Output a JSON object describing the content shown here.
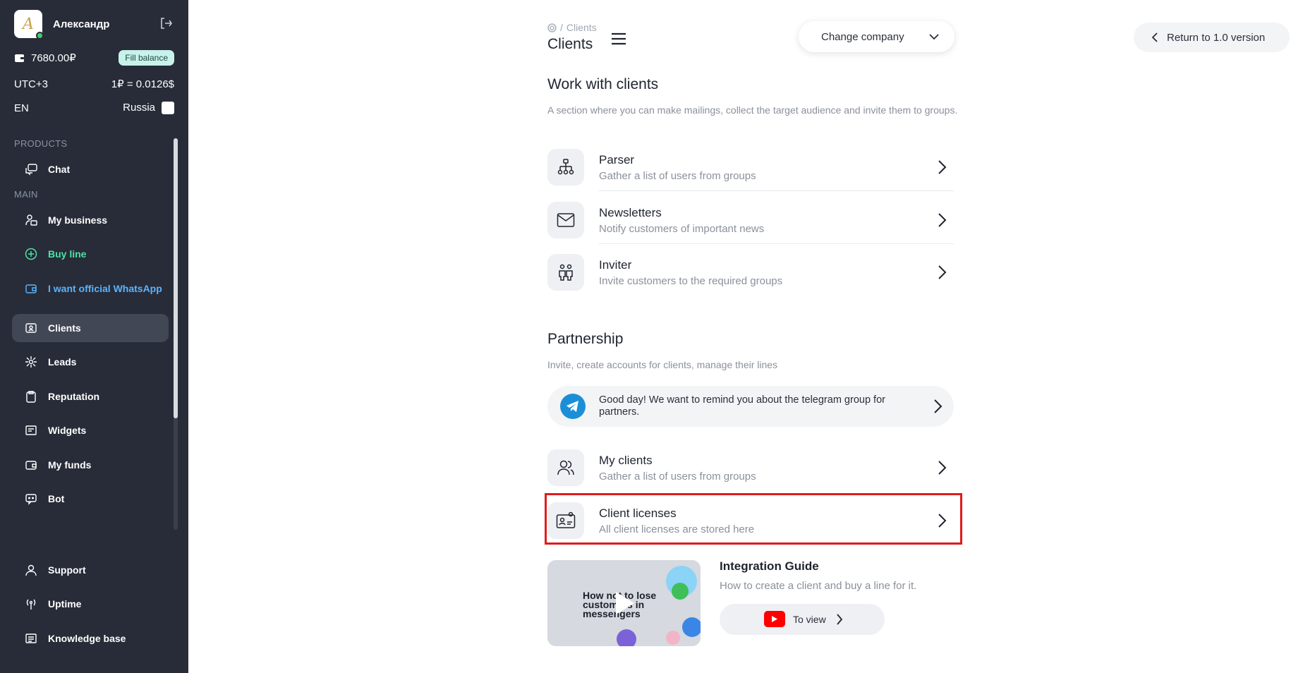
{
  "sidebar": {
    "user_name": "Александр",
    "balance": "7680.00₽",
    "fill_balance_label": "Fill balance",
    "timezone": "UTC+3",
    "rate": "1₽ = 0.0126$",
    "language": "EN",
    "country": "Russia",
    "sections": {
      "products": "PRODUCTS",
      "main": "MAIN"
    },
    "items": [
      {
        "label": "Chat",
        "icon": "chat-icon"
      },
      {
        "label": "My business",
        "icon": "business-icon"
      },
      {
        "label": "Buy line",
        "icon": "plus-circle-icon"
      },
      {
        "label": "I want official WhatsApp",
        "icon": "wallet-icon"
      },
      {
        "label": "Clients",
        "icon": "id-card-icon"
      },
      {
        "label": "Leads",
        "icon": "network-icon"
      },
      {
        "label": "Reputation",
        "icon": "clipboard-icon"
      },
      {
        "label": "Widgets",
        "icon": "widget-icon"
      },
      {
        "label": "My funds",
        "icon": "wallet-icon"
      },
      {
        "label": "Bot",
        "icon": "bot-icon"
      }
    ],
    "bottom_items": [
      {
        "label": "Support",
        "icon": "support-icon"
      },
      {
        "label": "Uptime",
        "icon": "antenna-icon"
      },
      {
        "label": "Knowledge base",
        "icon": "book-icon"
      }
    ],
    "colors": {
      "bg": "#272c38",
      "active": "#414755",
      "green": "#4be3a6",
      "blue": "#5ab4ff"
    }
  },
  "header": {
    "breadcrumb": "Clients",
    "title": "Clients",
    "company_select": "Change company",
    "return_label": "Return to 1.0 version"
  },
  "work": {
    "title": "Work with clients",
    "description": "A section where you can make mailings, collect the target audience and invite them to groups.",
    "items": [
      {
        "title": "Parser",
        "subtitle": "Gather a list of users from groups"
      },
      {
        "title": "Newsletters",
        "subtitle": "Notify customers of important news"
      },
      {
        "title": "Inviter",
        "subtitle": "Invite customers to the required groups"
      }
    ]
  },
  "partnership": {
    "title": "Partnership",
    "description": "Invite, create accounts for clients, manage their lines",
    "telegram_notice": "Good day! We want to remind you about the telegram group for partners.",
    "items": [
      {
        "title": "My clients",
        "subtitle": "Gather a list of users from groups"
      },
      {
        "title": "Client licenses",
        "subtitle": "All client licenses are stored here"
      }
    ]
  },
  "guide": {
    "title": "Integration Guide",
    "subtitle": "How to create a client and buy a line for it.",
    "view_label": "To view",
    "video_text": "How not to lose customers in messengers"
  }
}
